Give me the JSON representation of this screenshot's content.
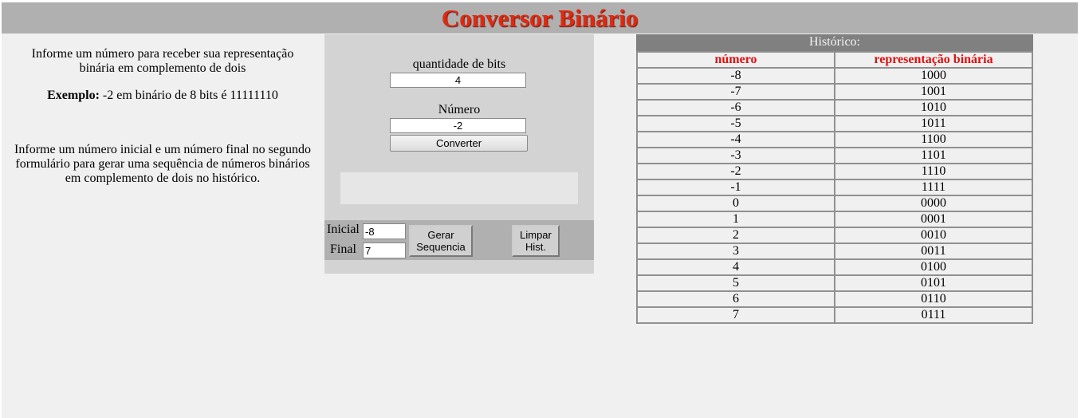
{
  "header": {
    "title": "Conversor Binário"
  },
  "info": {
    "intro": "Informe um número para receber sua representação binária em complemento de dois",
    "example_label": "Exemplo:",
    "example_text": " -2 em binário de 8 bits é 11111110",
    "sequence_help": "Informe um número inicial e um número final no segundo formulário para gerar uma sequência de números binários em complemento de dois no histórico."
  },
  "form": {
    "bits_label": "quantidade de bits",
    "bits_value": "4",
    "number_label": "Número",
    "number_value": "-2",
    "convert_label": "Converter",
    "result": ""
  },
  "sequence": {
    "start_label": "Inicial",
    "start_value": "-8",
    "end_label": "Final",
    "end_value": "7",
    "generate_line1": "Gerar",
    "generate_line2": "Sequencia",
    "clear_line1": "Limpar",
    "clear_line2": "Hist."
  },
  "history": {
    "title": "Histórico:",
    "columns": [
      "número",
      "representação binária"
    ],
    "rows": [
      [
        "-8",
        "1000"
      ],
      [
        "-7",
        "1001"
      ],
      [
        "-6",
        "1010"
      ],
      [
        "-5",
        "1011"
      ],
      [
        "-4",
        "1100"
      ],
      [
        "-3",
        "1101"
      ],
      [
        "-2",
        "1110"
      ],
      [
        "-1",
        "1111"
      ],
      [
        "0",
        "0000"
      ],
      [
        "1",
        "0001"
      ],
      [
        "2",
        "0010"
      ],
      [
        "3",
        "0011"
      ],
      [
        "4",
        "0100"
      ],
      [
        "5",
        "0101"
      ],
      [
        "6",
        "0110"
      ],
      [
        "7",
        "0111"
      ]
    ]
  },
  "colors": {
    "title": "#e02a10",
    "header_bg": "#b0b0b0",
    "table_header_text": "#e01010"
  }
}
